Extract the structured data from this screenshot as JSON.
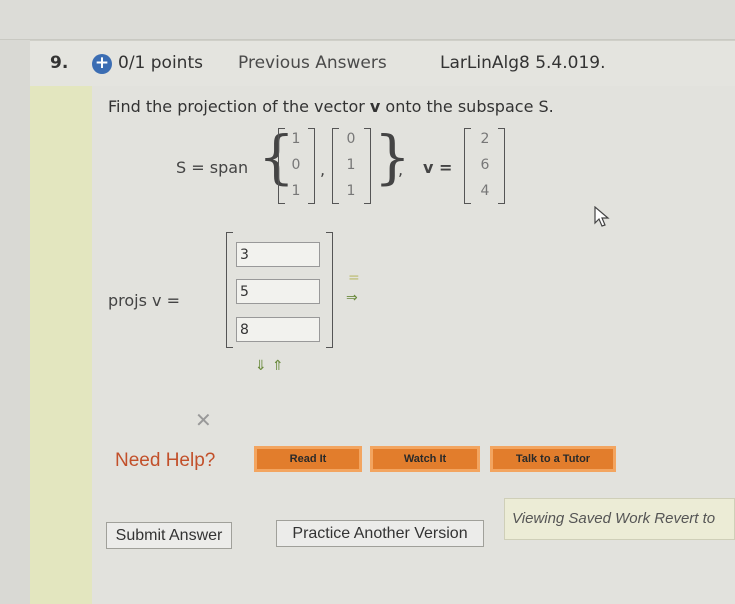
{
  "header": {
    "question_number": "9.",
    "points": "0/1 points",
    "previous_answers": "Previous Answers",
    "problem_id": "LarLinAlg8 5.4.019."
  },
  "problem": {
    "prompt_prefix": "Find the projection of the vector ",
    "prompt_vector": "v",
    "prompt_suffix": " onto the subspace S.",
    "s_label": "S = span",
    "v_label": "v =",
    "basis1": [
      "1",
      "0",
      "1"
    ],
    "basis2": [
      "0",
      "1",
      "1"
    ],
    "vector_v": [
      "2",
      "6",
      "4"
    ],
    "proj_label": "projs v ="
  },
  "answer": {
    "values": [
      "3",
      "5",
      "8"
    ]
  },
  "help": {
    "need_help": "Need Help?",
    "read_it": "Read It",
    "watch_it": "Watch It",
    "talk_to_tutor": "Talk to a Tutor"
  },
  "actions": {
    "submit": "Submit Answer",
    "practice": "Practice Another Version",
    "saved_work": "Viewing Saved Work Revert to"
  }
}
